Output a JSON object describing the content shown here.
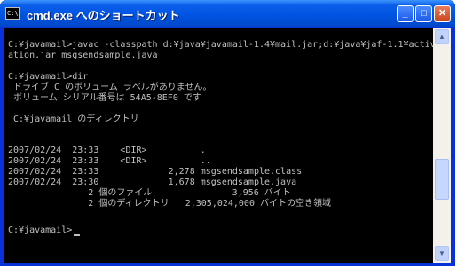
{
  "window": {
    "title": "cmd.exe へのショートカット",
    "icon_text": "C:\\",
    "buttons": {
      "minimize": "_",
      "maximize": "□",
      "close": "✕"
    }
  },
  "console": {
    "lines": [
      "",
      "C:¥javamail>javac -classpath d:¥java¥javamail-1.4¥mail.jar;d:¥java¥jaf-1.1¥activ",
      "ation.jar msgsendsample.java",
      "",
      "C:¥javamail>dir",
      " ドライブ C のボリューム ラベルがありません。",
      " ボリューム シリアル番号は 54A5-8EF0 です",
      "",
      " C:¥javamail のディレクトリ",
      "",
      "2007/02/24  23:33    <DIR>          .",
      "2007/02/24  23:33    <DIR>          ..",
      "2007/02/24  23:33             2,278 msgsendsample.class",
      "2007/02/24  23:30             1,678 msgsendsample.java",
      "               2 個のファイル               3,956 バイト",
      "               2 個のディレクトリ   2,305,024,000 バイトの空き領域",
      "",
      "C:¥javamail>"
    ]
  },
  "scrollbar": {
    "up_icon": "▲",
    "down_icon": "▼"
  }
}
